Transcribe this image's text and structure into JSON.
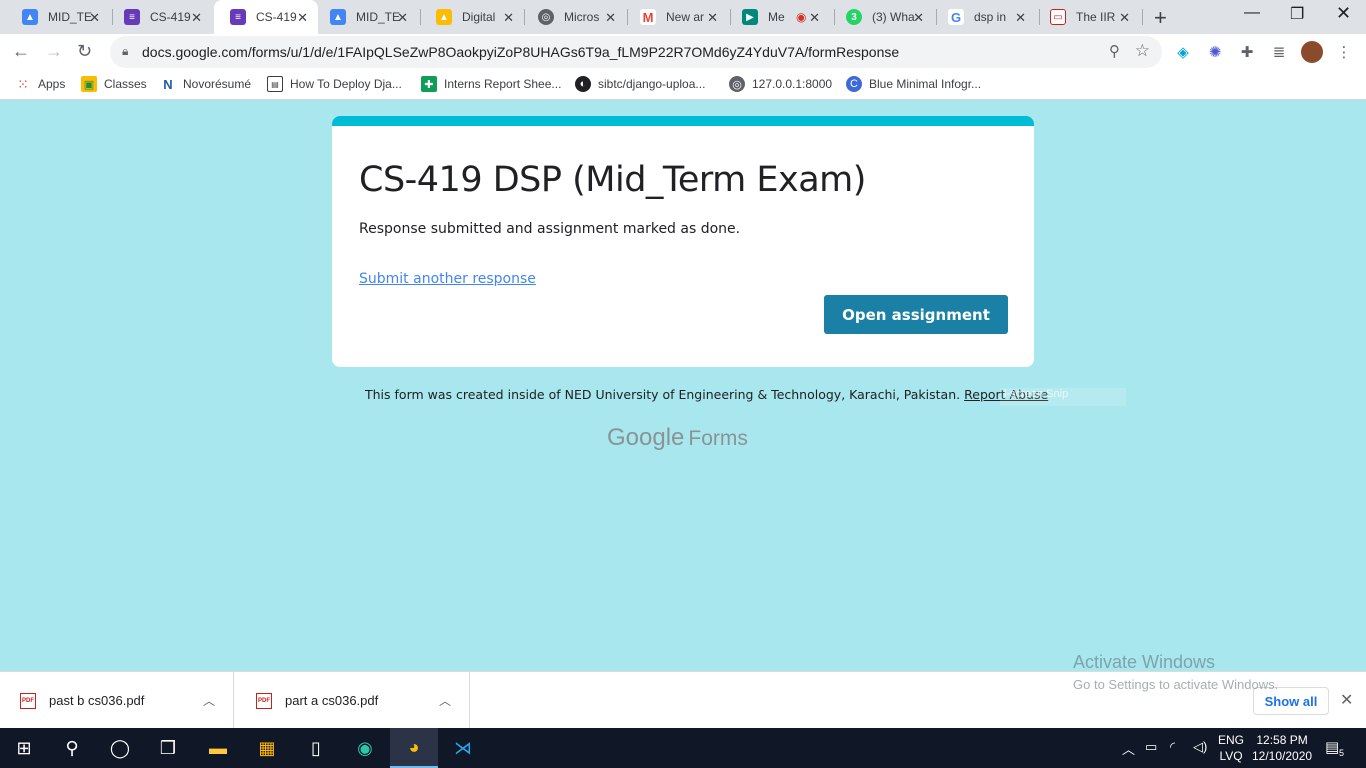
{
  "browser": {
    "tabs": [
      {
        "title": "MID_TE",
        "icon": "forms-person-icon",
        "color": "#4285f4"
      },
      {
        "title": "CS-419",
        "icon": "forms-icon",
        "color": "#673ab7"
      },
      {
        "title": "CS-419",
        "icon": "forms-icon",
        "color": "#673ab7",
        "active": true
      },
      {
        "title": "MID_TE",
        "icon": "forms-person-icon",
        "color": "#4285f4"
      },
      {
        "title": "Digital",
        "icon": "drive-icon",
        "color": "#fbbc04"
      },
      {
        "title": "Micros",
        "icon": "globe-icon",
        "color": "#5f6368"
      },
      {
        "title": "New ar",
        "icon": "gmail-icon",
        "color": "#ea4335"
      },
      {
        "title": "Me",
        "icon": "meet-icon",
        "color": "#00897b"
      },
      {
        "title": "(3) Wha",
        "icon": "whatsapp-icon",
        "color": "#25d366"
      },
      {
        "title": "dsp in",
        "icon": "google-icon",
        "color": "#4285f4"
      },
      {
        "title": "The IIR",
        "icon": "slides-icon",
        "color": "#c5221f"
      }
    ],
    "url": "docs.google.com/forms/u/1/d/e/1FAIpQLSeZwP8OaokpyiZoP8UHAGs6T9a_fLM9P22R7OMd6yZ4YduV7A/formResponse",
    "bookmarks": [
      {
        "label": "Apps",
        "icon": "apps-grid-icon"
      },
      {
        "label": "Classes",
        "icon": "classroom-icon"
      },
      {
        "label": "Novorésumé",
        "icon": "novoresume-icon"
      },
      {
        "label": "How To Deploy Dja...",
        "icon": "page-icon"
      },
      {
        "label": "Interns Report Shee...",
        "icon": "sheets-icon"
      },
      {
        "label": "sibtc/django-uploa...",
        "icon": "github-icon"
      },
      {
        "label": "127.0.0.1:8000",
        "icon": "globe-icon"
      },
      {
        "label": "Blue Minimal Infogr...",
        "icon": "canva-icon"
      }
    ]
  },
  "form": {
    "title": "CS-419 DSP (Mid_Term Exam)",
    "confirmation": "Response submitted and assignment marked as done.",
    "another_link": "Submit another response",
    "open_button": "Open assignment",
    "accent_color": "#00bcd4",
    "button_color": "#1a80a5"
  },
  "footer": {
    "note": "This form was created inside of NED University of Engineering & Technology, Karachi, Pakistan.",
    "report": "Report Abuse",
    "snip_ghost": "l-screen Snip",
    "google": "Google",
    "forms": "Forms"
  },
  "watermark": {
    "line1": "Activate Windows",
    "line2": "Go to Settings to activate Windows."
  },
  "downloads": {
    "items": [
      {
        "name": "past b cs036.pdf"
      },
      {
        "name": "part a cs036.pdf"
      }
    ],
    "show_all": "Show all"
  },
  "taskbar": {
    "lang_top": "ENG",
    "lang_bottom": "LVQ",
    "time": "12:58 PM",
    "date": "12/10/2020",
    "notification_count": "5"
  }
}
